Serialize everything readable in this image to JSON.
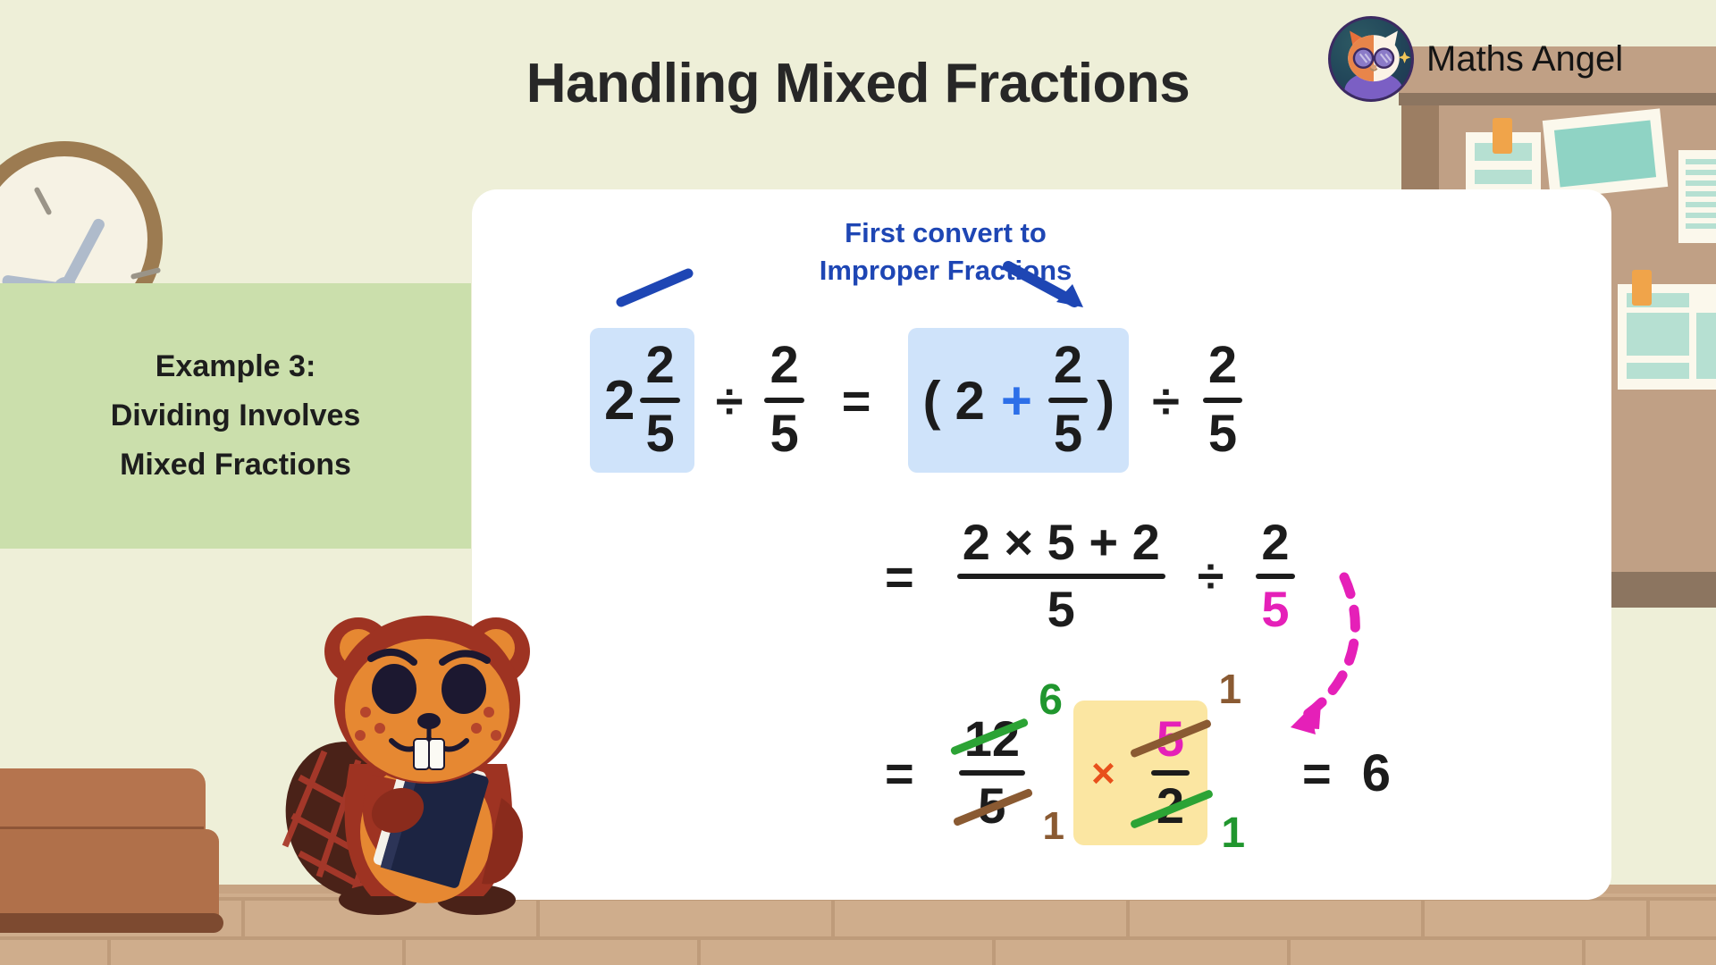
{
  "header": {
    "title": "Handling Mixed Fractions",
    "brand_name": "Maths Angel",
    "logo_icon": "cat-mascot-logo-icon"
  },
  "caption": {
    "line1": "Example 3:",
    "line2": "Dividing Involves",
    "line3": "Mixed Fractions"
  },
  "hint": {
    "line1": "First convert to",
    "line2": "Improper Fractions",
    "left_arrow_icon": "diagonal-line-icon",
    "right_arrow_icon": "arrow-down-right-icon",
    "color": "#1E46B4"
  },
  "math": {
    "row1": {
      "mixed": {
        "whole": "2",
        "num": "2",
        "den": "5"
      },
      "op1": "÷",
      "frac1": {
        "num": "2",
        "den": "5"
      },
      "equals": "=",
      "paren_open": "(",
      "whole2": "2",
      "plus": "+",
      "frac2": {
        "num": "2",
        "den": "5"
      },
      "paren_close": ")",
      "op2": "÷",
      "frac3": {
        "num": "2",
        "den": "5"
      }
    },
    "row2": {
      "equals": "=",
      "frac_big": {
        "num": "2 × 5 + 2",
        "den": "5"
      },
      "op": "÷",
      "frac": {
        "num": "2",
        "den": "5"
      },
      "den_color": "#E520B8"
    },
    "row3": {
      "equals": "=",
      "frac_left": {
        "num": "12",
        "den": "5",
        "num_cancel": "6",
        "den_cancel": "1"
      },
      "times": "×",
      "frac_right": {
        "num": "5",
        "den": "2",
        "num_cancel": "1",
        "den_cancel": "1"
      },
      "equals2": "=",
      "result": "6",
      "flip_arrow_icon": "curved-dashed-arrow-icon"
    }
  },
  "decor": {
    "clock_icon": "wall-clock-icon",
    "beaver_icon": "beaver-mascot-icon",
    "chair_icon": "armchair-icon",
    "corkboard_icon": "corkboard-icon"
  },
  "colors": {
    "wall": "#EEEFD8",
    "caption_bg": "#CBDFAC",
    "card_bg": "#FFFFFF",
    "highlight_blue": "#CFE3FA",
    "highlight_yellow": "#FBE6A2",
    "accent_blue": "#2D6FE8",
    "accent_pink": "#E520B8",
    "accent_green": "#20962E",
    "accent_brown": "#8A5A32",
    "accent_orange": "#E8501B"
  }
}
